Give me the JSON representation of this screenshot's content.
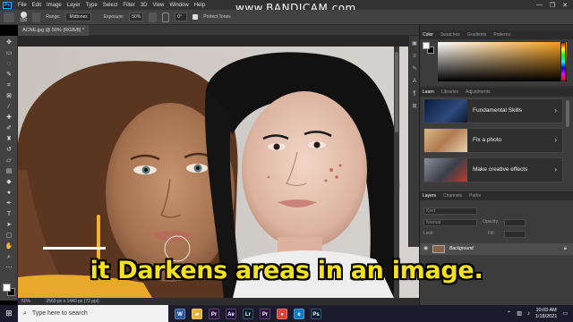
{
  "watermark": "www.BANDICAM.com",
  "menubar": {
    "logo": "Ps",
    "items": [
      "File",
      "Edit",
      "Image",
      "Layer",
      "Type",
      "Select",
      "Filter",
      "3D",
      "View",
      "Window",
      "Help"
    ],
    "controls": [
      "—",
      "❐",
      "✕"
    ]
  },
  "options": {
    "brush_size": "150",
    "range_label": "Range:",
    "range_value": "Midtones",
    "exposure_label": "Exposure:",
    "exposure_value": "50%",
    "angle_value": "0°",
    "protect_tones": "Protect Tones"
  },
  "document": {
    "tab": "ACNE.jpg @ 50% (RGB/8) *"
  },
  "status": {
    "zoom": "50%",
    "dimensions": "2560 px x 1440 px (72 ppi)"
  },
  "subtitle": "it Darkens areas in an image.",
  "panels": {
    "color_tabs": [
      "Color",
      "Swatches",
      "Gradients",
      "Patterns"
    ],
    "learn_tabs": [
      "Learn",
      "Libraries",
      "Adjustments"
    ],
    "learn_cards": [
      {
        "label": "Fundamental Skills",
        "thumb_icon": "dark-room-thumbnail"
      },
      {
        "label": "Fix a photo",
        "thumb_icon": "house-photo-thumbnail"
      },
      {
        "label": "Make creative effects",
        "thumb_icon": "creative-effects-thumbnail"
      }
    ],
    "layers_tabs": [
      "Layers",
      "Channels",
      "Paths"
    ],
    "layers": {
      "kind_placeholder": "Kind",
      "blend_mode": "Normal",
      "opacity_label": "Opacity:",
      "lock_label": "Lock:",
      "fill_label": "Fill:",
      "layer_name": "Background"
    }
  },
  "taskbar": {
    "search_placeholder": "Type here to search",
    "apps": [
      {
        "name": "Word",
        "glyph": "W",
        "color": "#2b579a"
      },
      {
        "name": "File Explorer",
        "glyph": "▰",
        "color": "#e8b33a"
      },
      {
        "name": "Premiere Pro",
        "glyph": "Pr",
        "color": "#2a0a3a"
      },
      {
        "name": "After Effects",
        "glyph": "Ae",
        "color": "#1f0c3a"
      },
      {
        "name": "Lightroom",
        "glyph": "Lr",
        "color": "#001a2e"
      },
      {
        "name": "Premiere Pro 2",
        "glyph": "Pr",
        "color": "#2a0a3a"
      },
      {
        "name": "Chrome",
        "glyph": "●",
        "color": "#db4437"
      },
      {
        "name": "Edge",
        "glyph": "e",
        "color": "#0a7cc2"
      },
      {
        "name": "Photoshop",
        "glyph": "Ps",
        "color": "#001e36"
      }
    ],
    "time": "10:03 AM",
    "date": "1/18/2021"
  },
  "colors": {
    "app_bg": "#323232",
    "accent": "#31a8ff",
    "subtitle": "#f7e11a"
  }
}
